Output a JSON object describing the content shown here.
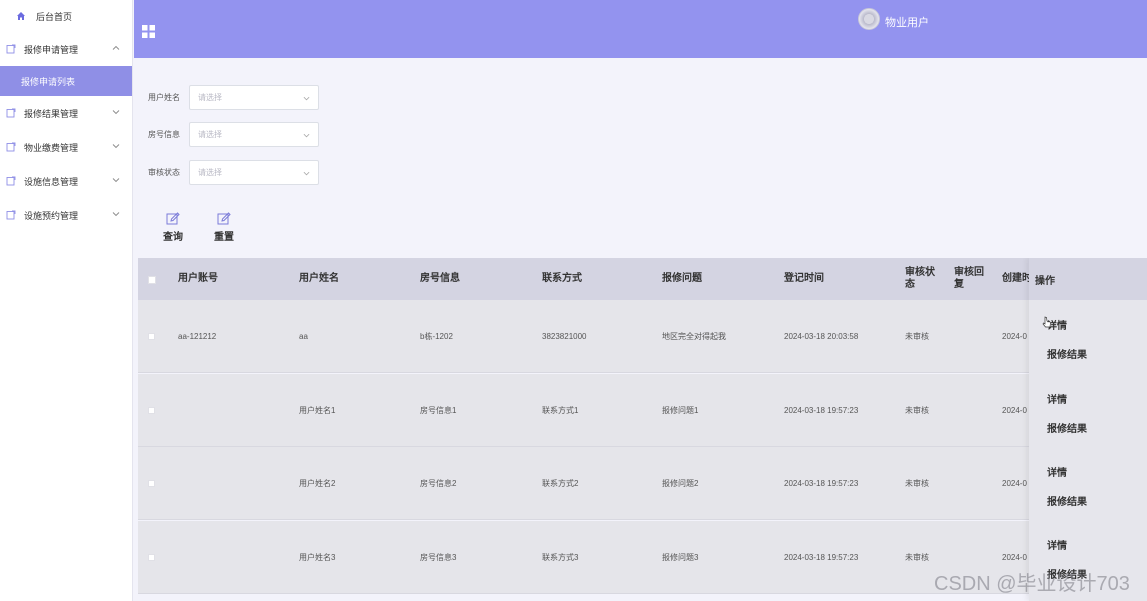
{
  "sidebar": {
    "home": "后台首页",
    "menus": [
      {
        "label": "报修申请管理",
        "expanded": true
      },
      {
        "label": "报修结果管理",
        "expanded": false
      },
      {
        "label": "物业缴费管理",
        "expanded": false
      },
      {
        "label": "设施信息管理",
        "expanded": false
      },
      {
        "label": "设施预约管理",
        "expanded": false
      }
    ],
    "active_sub": "报修申请列表"
  },
  "header": {
    "user": "物业用户"
  },
  "filters": [
    {
      "label": "用户姓名",
      "placeholder": "请选择"
    },
    {
      "label": "房号信息",
      "placeholder": "请选择"
    },
    {
      "label": "审核状态",
      "placeholder": "请选择"
    }
  ],
  "actions": {
    "search": "查询",
    "reset": "重置"
  },
  "table": {
    "columns": [
      "用户账号",
      "用户姓名",
      "房号信息",
      "联系方式",
      "报修问题",
      "登记时间",
      "审核状\n态",
      "审核回\n复",
      "创建时"
    ],
    "ops_header": "操作",
    "rows": [
      {
        "account": "aa-121212",
        "name": "aa",
        "room": "b栋-1202",
        "phone": "3823821000",
        "issue": "地区完全对得起我",
        "time": "2024-03-18 20:03:58",
        "status": "未审核",
        "reply": "",
        "created": "2024-0"
      },
      {
        "account": "",
        "name": "用户姓名1",
        "room": "房号信息1",
        "phone": "联系方式1",
        "issue": "报修问题1",
        "time": "2024-03-18 19:57:23",
        "status": "未审核",
        "reply": "",
        "created": "2024-0"
      },
      {
        "account": "",
        "name": "用户姓名2",
        "room": "房号信息2",
        "phone": "联系方式2",
        "issue": "报修问题2",
        "time": "2024-03-18 19:57:23",
        "status": "未审核",
        "reply": "",
        "created": "2024-0"
      },
      {
        "account": "",
        "name": "用户姓名3",
        "room": "房号信息3",
        "phone": "联系方式3",
        "issue": "报修问题3",
        "time": "2024-03-18 19:57:23",
        "status": "未审核",
        "reply": "",
        "created": "2024-0"
      }
    ],
    "op_detail": "详情",
    "op_result": "报修结果"
  },
  "watermark": "CSDN @毕业设计703",
  "colors": {
    "header": "#9393ef",
    "active_menu": "#8f8fe6",
    "table_header": "#d4d4e2",
    "row_bg": "#e5e5ea"
  }
}
